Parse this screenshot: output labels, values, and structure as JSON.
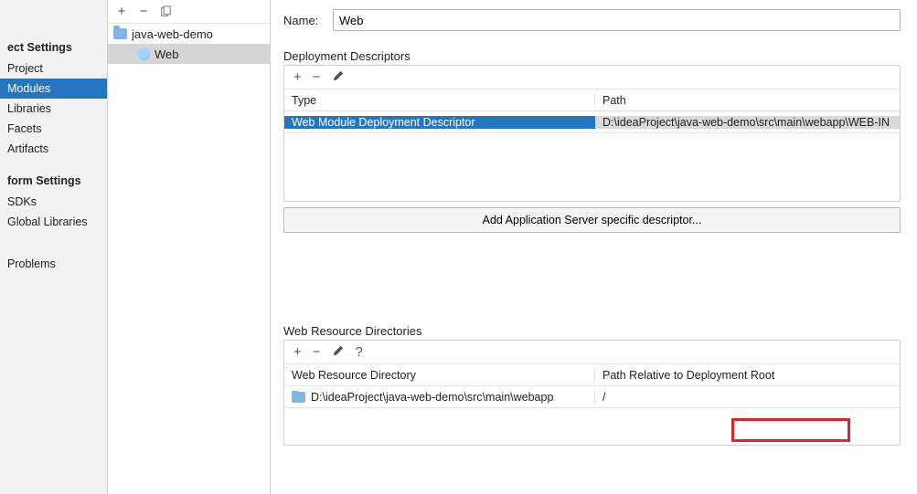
{
  "sidebar": {
    "sections": [
      {
        "heading": "ect Settings",
        "items": [
          "Project",
          "Modules",
          "Libraries",
          "Facets",
          "Artifacts"
        ],
        "selected": 1
      },
      {
        "heading": "form Settings",
        "items": [
          "SDKs",
          "Global Libraries"
        ]
      }
    ],
    "extra": [
      "Problems"
    ]
  },
  "tree": {
    "root": "java-web-demo",
    "child": "Web"
  },
  "form": {
    "name_label": "Name:",
    "name_value": "Web"
  },
  "dd": {
    "title": "Deployment Descriptors",
    "type_header": "Type",
    "path_header": "Path",
    "row_type": "Web Module Deployment Descriptor",
    "row_path": "D:\\ideaProject\\java-web-demo\\src\\main\\webapp\\WEB-IN",
    "add_server_btn": "Add Application Server specific descriptor..."
  },
  "wr": {
    "title": "Web Resource Directories",
    "dir_header": "Web Resource Directory",
    "rel_header": "Path Relative to Deployment Root",
    "row_dir": "D:\\ideaProject\\java-web-demo\\src\\main\\webapp",
    "row_rel": "/"
  }
}
